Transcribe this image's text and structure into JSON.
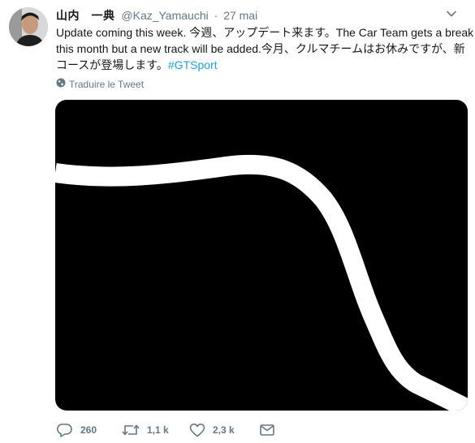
{
  "tweet": {
    "author_name": "山内　一典",
    "author_handle": "@Kaz_Yamauchi",
    "separator": "·",
    "date": "27 mai",
    "text_line1": "Update coming this week. 今週、アップデート来ます。The Car Team gets a break",
    "text_line2": "this month but a new track will be added.今月、クルマチームはお休みですが、新",
    "text_line3_prefix": "コースが登場します。",
    "hashtag": "#GTSport",
    "translate_label": "Traduire le Tweet"
  },
  "actions": {
    "replies": "260",
    "retweets": "1,1 k",
    "likes": "2,3 k"
  },
  "icons": {
    "avatar": "avatar",
    "caret": "chevron-down-icon",
    "globe": "globe-icon",
    "reply": "reply-icon",
    "retweet": "retweet-icon",
    "like": "heart-icon",
    "message": "envelope-icon"
  },
  "colors": {
    "text": "#14171a",
    "secondary": "#657786",
    "link": "#1da1f2",
    "media_background": "#000000",
    "track_line": "#ffffff"
  }
}
